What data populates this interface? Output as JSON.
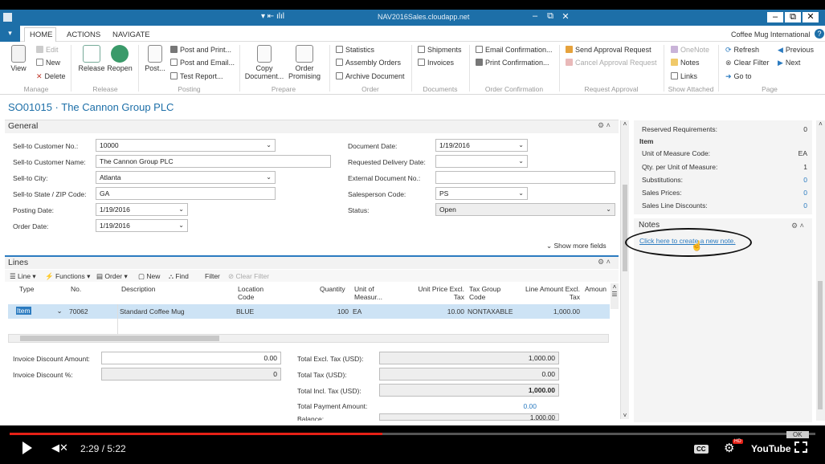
{
  "window": {
    "title": "NAV2016Sales.cloudapp.net",
    "controls": [
      "–",
      "⧉",
      "✕"
    ]
  },
  "ribbon_tabs": [
    "HOME",
    "ACTIONS",
    "NAVIGATE"
  ],
  "company": "Coffee Mug International",
  "groups": {
    "manage": {
      "name": "Manage",
      "view": "View",
      "edit": "Edit",
      "new": "New",
      "delete": "Delete"
    },
    "release": {
      "name": "Release",
      "release": "Release",
      "reopen": "Reopen"
    },
    "posting": {
      "name": "Posting",
      "post": "Post...",
      "post_print": "Post and Print...",
      "post_email": "Post and Email...",
      "test_report": "Test Report..."
    },
    "prepare": {
      "name": "Prepare",
      "copy_doc": "Copy Document...",
      "order_promising": "Order Promising"
    },
    "order": {
      "name": "Order",
      "statistics": "Statistics",
      "assembly": "Assembly Orders",
      "archive": "Archive Document"
    },
    "documents": {
      "name": "Documents",
      "shipments": "Shipments",
      "invoices": "Invoices"
    },
    "order_conf": {
      "name": "Order Confirmation",
      "email_conf": "Email Confirmation...",
      "print_conf": "Print Confirmation..."
    },
    "approval": {
      "name": "Request Approval",
      "send": "Send Approval Request",
      "cancel": "Cancel Approval Request"
    },
    "attached": {
      "name": "Show Attached",
      "onenote": "OneNote",
      "notes": "Notes",
      "links": "Links"
    },
    "page": {
      "name": "Page",
      "refresh": "Refresh",
      "clear_filter": "Clear Filter",
      "go_to": "Go to",
      "previous": "Previous",
      "next": "Next"
    }
  },
  "page_title": "SO01015 · The Cannon Group PLC",
  "general": {
    "title": "General",
    "fields_left": [
      {
        "label": "Sell-to Customer No.:",
        "value": "10000"
      },
      {
        "label": "Sell-to Customer Name:",
        "value": "The Cannon Group PLC"
      },
      {
        "label": "Sell-to City:",
        "value": "Atlanta"
      },
      {
        "label": "Sell-to State / ZIP Code:",
        "value": "GA"
      },
      {
        "label": "Posting Date:",
        "value": "1/19/2016"
      },
      {
        "label": "Order Date:",
        "value": "1/19/2016"
      }
    ],
    "fields_right": [
      {
        "label": "Document Date:",
        "value": "1/19/2016"
      },
      {
        "label": "Requested Delivery Date:",
        "value": ""
      },
      {
        "label": "External Document No.:",
        "value": ""
      },
      {
        "label": "Salesperson Code:",
        "value": "PS"
      },
      {
        "label": "Status:",
        "value": "Open"
      }
    ],
    "show_more": "Show more fields"
  },
  "lines": {
    "title": "Lines",
    "toolbar": [
      "Line",
      "Functions",
      "Order",
      "New",
      "Find",
      "Filter",
      "Clear Filter"
    ],
    "headers": [
      "Type",
      "No.",
      "Description",
      "Location Code",
      "Quantity",
      "Unit of Measur...",
      "Unit Price Excl. Tax",
      "Tax Group Code",
      "Line Amount Excl. Tax",
      "Amoun"
    ],
    "rows": [
      {
        "type": "Item",
        "no": "70062",
        "description": "Standard Coffee Mug",
        "location": "BLUE",
        "quantity": "100",
        "uom": "EA",
        "unit_price": "10.00",
        "tax_group": "NONTAXABLE",
        "line_amount": "1,000.00"
      }
    ]
  },
  "totals": {
    "inv_disc_amount_label": "Invoice Discount Amount:",
    "inv_disc_amount": "0.00",
    "inv_disc_pct_label": "Invoice Discount %:",
    "inv_disc_pct": "0",
    "excl_label": "Total Excl. Tax (USD):",
    "excl": "1,000.00",
    "tax_label": "Total Tax (USD):",
    "tax": "0.00",
    "incl_label": "Total Incl. Tax (USD):",
    "incl": "1,000.00",
    "payment_label": "Total Payment Amount:",
    "payment": "0.00",
    "balance_label": "Balance:",
    "balance": "1,000.00"
  },
  "factbox": {
    "reserved_label": "Reserved Requirements:",
    "reserved": "0",
    "item_heading": "Item",
    "uom_label": "Unit of Measure Code:",
    "uom": "EA",
    "qty_label": "Qty. per Unit of Measure:",
    "qty": "1",
    "subs_label": "Substitutions:",
    "subs": "0",
    "prices_label": "Sales Prices:",
    "prices": "0",
    "disc_label": "Sales Line Discounts:",
    "disc": "0",
    "notes_title": "Notes",
    "notes_link": "Click here to create a new note."
  },
  "player": {
    "time": "2:29 / 5:22",
    "progress": 0.463,
    "cc": "CC",
    "hd": "HD",
    "youtube": "YouTube",
    "ok": "OK"
  },
  "colors": {
    "accent": "#1d6fa8",
    "link": "#2b7bc0",
    "progress": "#e62117",
    "selected_row": "#cde3f5"
  }
}
